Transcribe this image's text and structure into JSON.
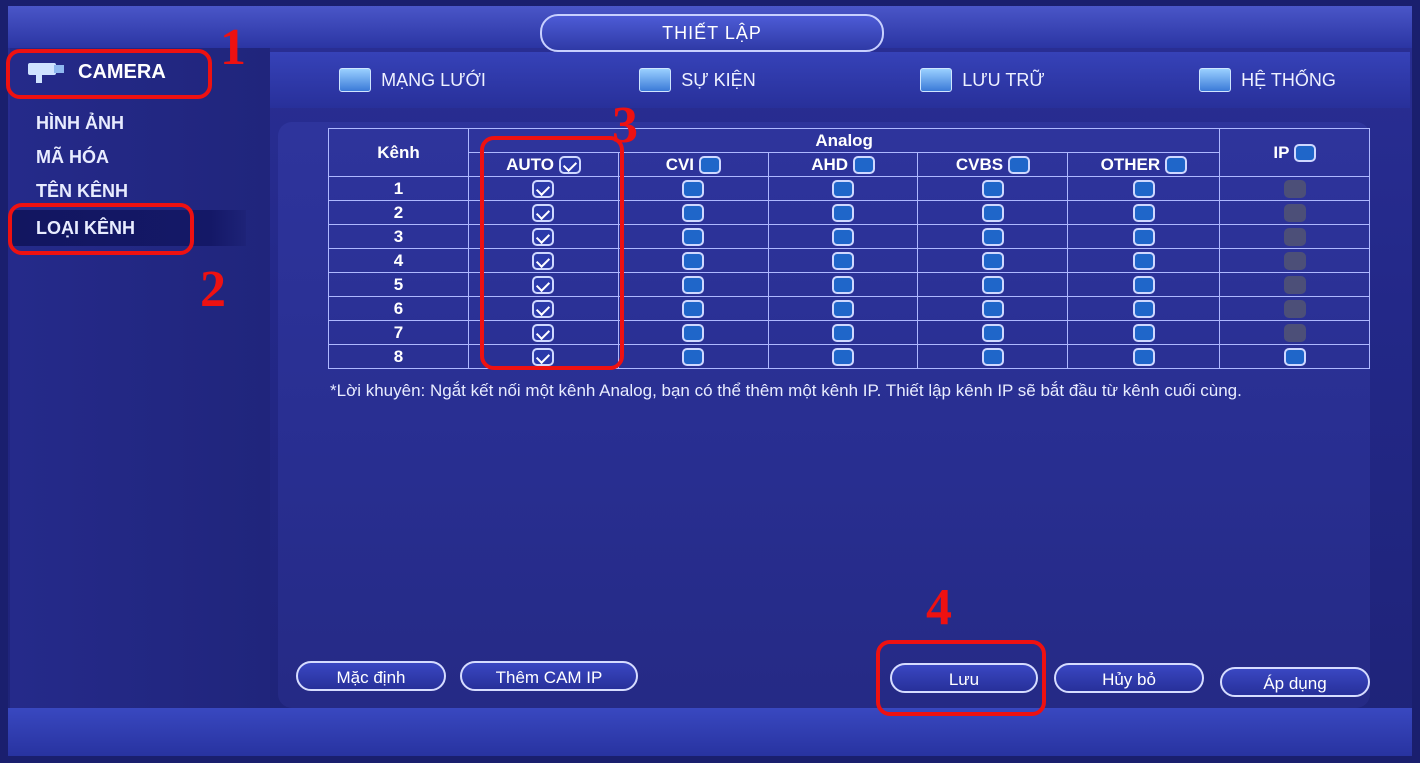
{
  "title": "THIẾT LẬP",
  "sidebar": {
    "header": "CAMERA",
    "items": [
      "HÌNH ẢNH",
      "MÃ HÓA",
      "TÊN KÊNH",
      "LOẠI KÊNH"
    ]
  },
  "tabs": [
    {
      "label": "MẠNG LƯỚI",
      "icon": "network-icon"
    },
    {
      "label": "SỰ KIỆN",
      "icon": "event-icon"
    },
    {
      "label": "LƯU TRỮ",
      "icon": "storage-icon"
    },
    {
      "label": "HỆ THỐNG",
      "icon": "system-icon"
    }
  ],
  "table": {
    "channel_header": "Kênh",
    "analog_header": "Analog",
    "columns": [
      "AUTO",
      "CVI",
      "AHD",
      "CVBS",
      "OTHER",
      "IP"
    ],
    "rows": [
      "1",
      "2",
      "3",
      "4",
      "5",
      "6",
      "7",
      "8"
    ]
  },
  "note": "*Lời khuyên: Ngắt kết nối một kênh Analog, bạn có thể thêm một kênh IP. Thiết lập kênh IP sẽ bắt đầu từ kênh cuối cùng.",
  "buttons": {
    "default": "Mặc định",
    "add_ip": "Thêm CAM IP",
    "save": "Lưu",
    "cancel": "Hủy bỏ",
    "apply": "Áp dụng"
  },
  "annotations": [
    "1",
    "2",
    "3",
    "4"
  ],
  "colors": {
    "annotation": "#e11111",
    "accent": "#1f66c9"
  }
}
